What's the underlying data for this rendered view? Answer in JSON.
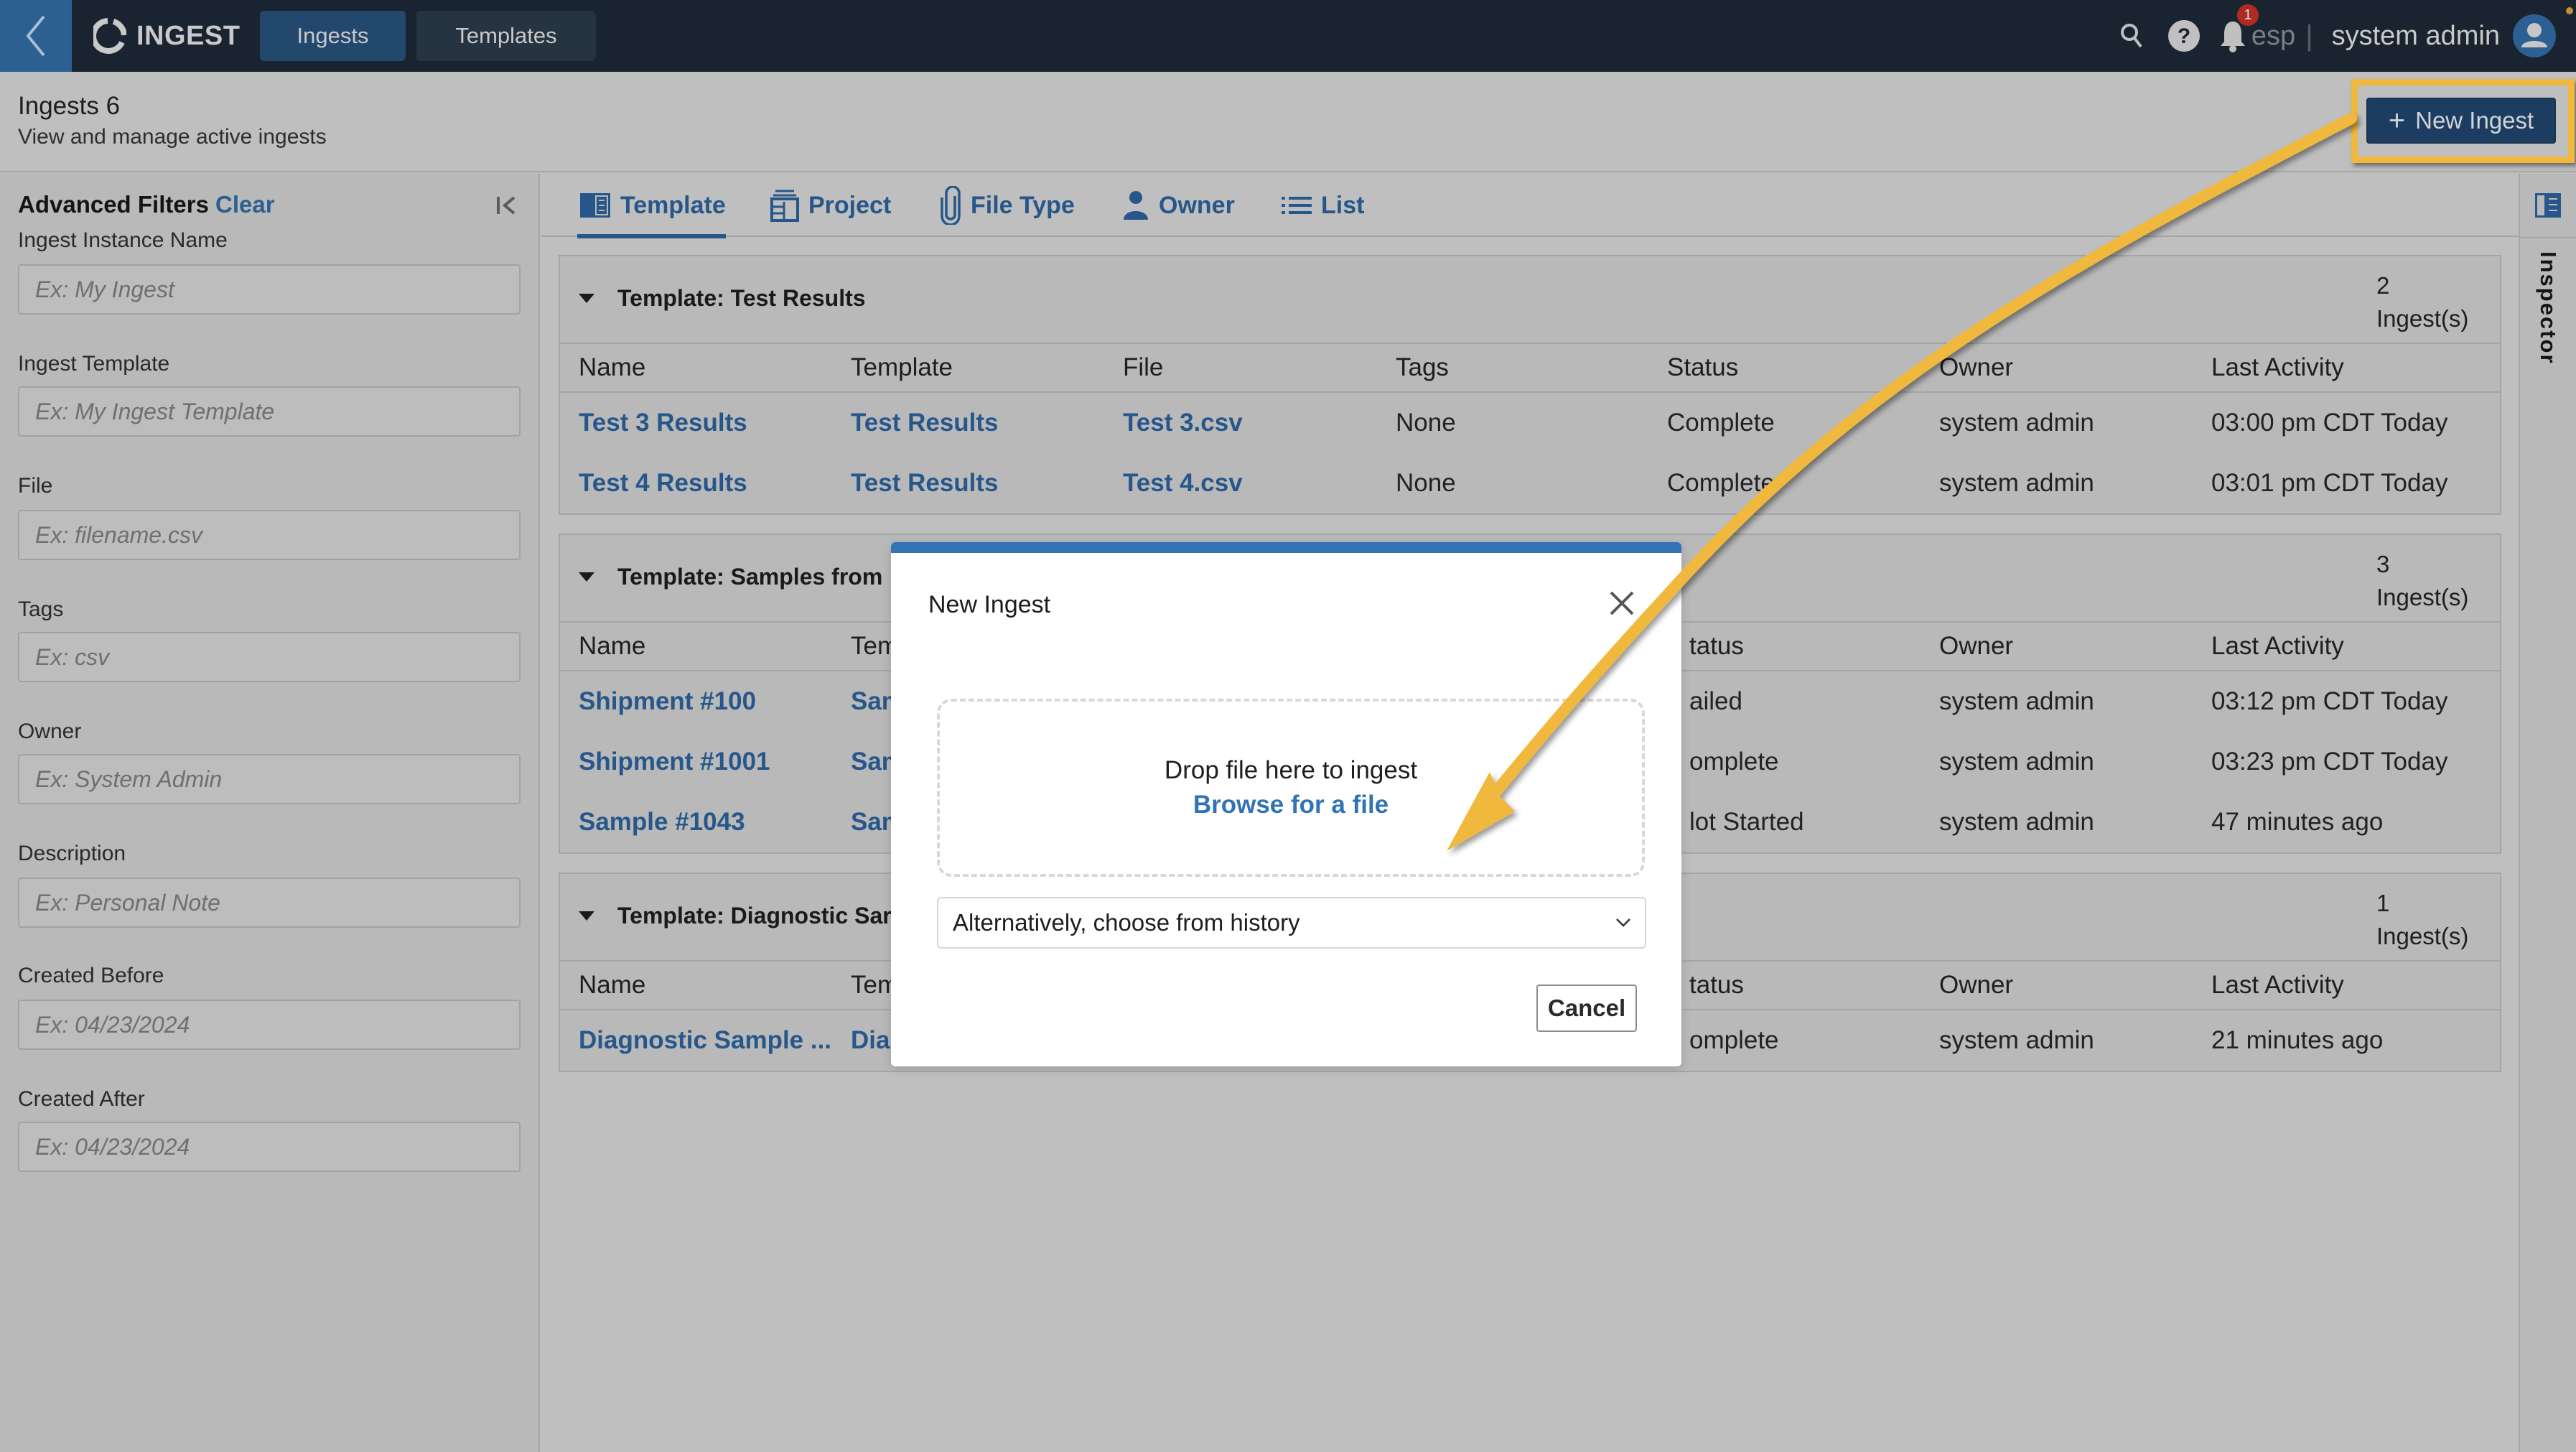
{
  "topnav": {
    "app_name": "INGEST",
    "tabs": [
      {
        "label": "Ingests",
        "active": true
      },
      {
        "label": "Templates",
        "active": false
      }
    ],
    "notifications_count": "1",
    "workspace": "esp",
    "separator": "|",
    "user_name": "system admin"
  },
  "header": {
    "title": "Ingests 6",
    "subtitle": "View and manage active ingests",
    "new_ingest_label": "New Ingest",
    "new_ingest_icon": "+"
  },
  "sidebar": {
    "title": "Advanced Filters",
    "clear_label": "Clear",
    "filters": [
      {
        "label": "Ingest Instance Name",
        "placeholder": "Ex: My Ingest",
        "value": ""
      },
      {
        "label": "Ingest Template",
        "placeholder": "Ex: My Ingest Template",
        "value": ""
      },
      {
        "label": "File",
        "placeholder": "Ex: filename.csv",
        "value": ""
      },
      {
        "label": "Tags",
        "placeholder": "Ex: csv",
        "value": ""
      },
      {
        "label": "Owner",
        "placeholder": "Ex: System Admin",
        "value": ""
      },
      {
        "label": "Description",
        "placeholder": "Ex: Personal Note",
        "value": ""
      },
      {
        "label": "Created Before",
        "placeholder": "Ex: 04/23/2024",
        "value": ""
      },
      {
        "label": "Created After",
        "placeholder": "Ex: 04/23/2024",
        "value": ""
      }
    ]
  },
  "view_tabs": [
    {
      "label": "Template",
      "icon": "template-icon",
      "active": true
    },
    {
      "label": "Project",
      "icon": "project-icon",
      "active": false
    },
    {
      "label": "File Type",
      "icon": "paperclip-icon",
      "active": false
    },
    {
      "label": "Owner",
      "icon": "person-icon",
      "active": false
    },
    {
      "label": "List",
      "icon": "list-icon",
      "active": false
    }
  ],
  "columns": [
    "Name",
    "Template",
    "File",
    "Tags",
    "Status",
    "Owner",
    "Last Activity"
  ],
  "groups": [
    {
      "title": "Template: Test Results",
      "count": "2",
      "count_label": "Ingest(s)",
      "rows": [
        {
          "name": "Test 3 Results",
          "template": "Test Results",
          "file": "Test 3.csv",
          "tags": "None",
          "status": "Complete",
          "owner": "system admin",
          "last_activity": "03:00 pm CDT Today"
        },
        {
          "name": "Test 4 Results",
          "template": "Test Results",
          "file": "Test 4.csv",
          "tags": "None",
          "status": "Complete",
          "owner": "system admin",
          "last_activity": "03:01 pm CDT Today"
        }
      ]
    },
    {
      "title": "Template: Samples from",
      "count": "3",
      "count_label": "Ingest(s)",
      "rows": [
        {
          "name": "Shipment #100",
          "template": "Sam",
          "file": "",
          "tags": "",
          "status": "ailed",
          "owner": "system admin",
          "last_activity": "03:12 pm CDT Today"
        },
        {
          "name": "Shipment #1001",
          "template": "Sam",
          "file": "",
          "tags": "",
          "status": "omplete",
          "owner": "system admin",
          "last_activity": "03:23 pm CDT Today"
        },
        {
          "name": "Sample #1043",
          "template": "Sam",
          "file": "",
          "tags": "",
          "status": "lot Started",
          "owner": "system admin",
          "last_activity": "47 minutes ago"
        }
      ]
    },
    {
      "title": "Template: Diagnostic Sar",
      "count": "1",
      "count_label": "Ingest(s)",
      "rows": [
        {
          "name": "Diagnostic Sample ...",
          "template": "Dia",
          "file": "",
          "tags": "",
          "status": "omplete",
          "owner": "system admin",
          "last_activity": "21 minutes ago"
        }
      ]
    }
  ],
  "partial_headers": {
    "template": "Tem",
    "status": "tatus"
  },
  "inspector": {
    "label": "Inspector"
  },
  "modal": {
    "title": "New Ingest",
    "drop_text": "Drop file here to ingest",
    "browse_label": "Browse for a file",
    "history_select_value": "Alternatively, choose from history",
    "cancel_label": "Cancel"
  },
  "colors": {
    "nav_bg": "#1a2431",
    "accent_blue": "#27578a",
    "modal_accent": "#3273b4",
    "annotation": "#f0b93e",
    "badge_red": "#b02a22"
  }
}
